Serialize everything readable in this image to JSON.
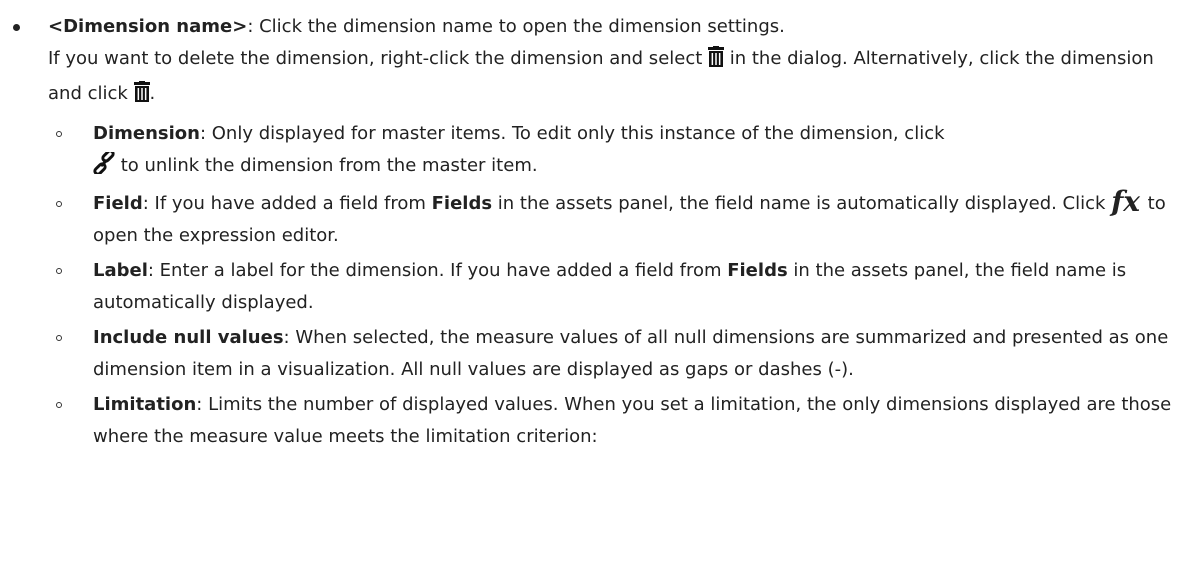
{
  "item": {
    "name": "<Dimension name>",
    "desc": ": Click the dimension name to open the dimension settings.",
    "delete_a": "If you want to delete the dimension, right-click the dimension and select ",
    "delete_b": " in the dialog. Alternatively, click the dimension and click ",
    "delete_c": "."
  },
  "sub": [
    {
      "term": "Dimension",
      "text_a": ": Only displayed for master items. To edit only this instance of the dimension, click ",
      "text_b": " to unlink the dimension from the master item."
    },
    {
      "term": "Field",
      "text_a": ": If you have added a field from ",
      "bold": "Fields",
      "text_b": " in the assets panel, the field name is automatically displayed. Click ",
      "fx": "fx",
      "text_c": " to open the expression editor."
    },
    {
      "term": "Label",
      "text_a": ": Enter a label for the dimension. If you have added a field from ",
      "bold": "Fields",
      "text_b": " in the assets panel, the field name is automatically displayed."
    },
    {
      "term": "Include null values",
      "text_a": ": When selected, the measure values of all null dimensions are summarized and presented as one dimension item in a visualization. All null values are displayed as gaps or dashes (-)."
    },
    {
      "term": "Limitation",
      "text_a": ": Limits the number of displayed values. When you set a limitation, the only dimensions displayed are those where the measure value meets the limitation criterion:"
    }
  ],
  "icons": {
    "delete": "trash-icon",
    "unlink": "link-icon",
    "expression": "fx-icon"
  }
}
